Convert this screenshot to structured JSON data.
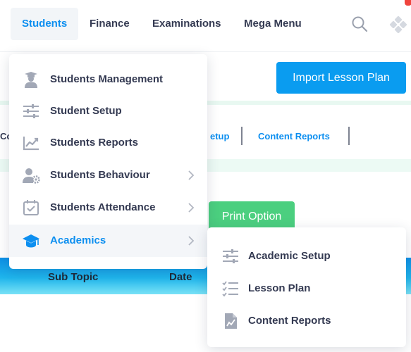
{
  "nav": {
    "items": [
      {
        "label": "Students",
        "active": true
      },
      {
        "label": "Finance"
      },
      {
        "label": "Examinations"
      },
      {
        "label": "Mega Menu"
      }
    ],
    "icons": [
      "search-icon",
      "apps-icon"
    ]
  },
  "background": {
    "import_button": "Import Lesson Plan",
    "tab_left_fragment": "Co",
    "tab_setup_fragment": "etup",
    "tab_content_reports": "Content Reports",
    "print_button": "Print Option",
    "table_headers": [
      "Sub Topic",
      "Date"
    ]
  },
  "menu": {
    "items": [
      {
        "label": "Students Management",
        "icon": "graduate-user-icon",
        "has_submenu": false
      },
      {
        "label": "Student Setup",
        "icon": "sliders-icon",
        "has_submenu": false
      },
      {
        "label": "Students Reports",
        "icon": "chart-line-icon",
        "has_submenu": false
      },
      {
        "label": "Students Behaviour",
        "icon": "user-gear-icon",
        "has_submenu": true
      },
      {
        "label": "Students Attendance",
        "icon": "calendar-check-icon",
        "has_submenu": true
      },
      {
        "label": "Academics",
        "icon": "graduation-cap-icon",
        "has_submenu": true,
        "active": true
      }
    ]
  },
  "submenu": {
    "items": [
      {
        "label": "Academic Setup",
        "icon": "sliders-icon"
      },
      {
        "label": "Lesson Plan",
        "icon": "checklist-icon"
      },
      {
        "label": "Content Reports",
        "icon": "report-file-icon"
      }
    ]
  },
  "colors": {
    "accent": "#0d8ff0",
    "import_button": "#0a9cf0",
    "print_button": "#4bcf7f",
    "text": "#343a52",
    "icon": "#a2a8b6",
    "notification": "#f0443d"
  }
}
